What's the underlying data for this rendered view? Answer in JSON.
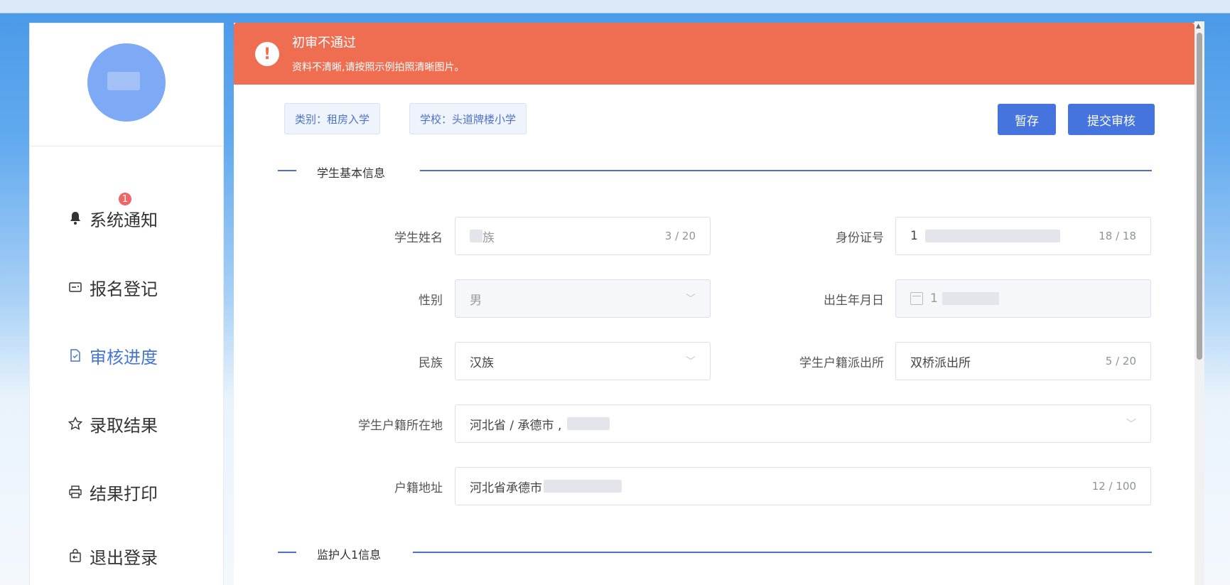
{
  "sidebar": {
    "items": [
      {
        "label": "系统通知",
        "icon": "bell-icon",
        "badge": "1"
      },
      {
        "label": "报名登记",
        "icon": "id-card-icon"
      },
      {
        "label": "审核进度",
        "icon": "document-check-icon",
        "active": true
      },
      {
        "label": "录取结果",
        "icon": "star-icon"
      },
      {
        "label": "结果打印",
        "icon": "printer-icon"
      },
      {
        "label": "退出登录",
        "icon": "logout-icon"
      }
    ]
  },
  "alert": {
    "title": "初审不通过",
    "desc": "资料不清晰,请按照示例拍照清晰图片。"
  },
  "tags": {
    "category": "类别：租房入学",
    "school": "学校：头道牌楼小学"
  },
  "buttons": {
    "save": "暂存",
    "submit": "提交审核"
  },
  "sections": {
    "student": "学生基本信息",
    "guardian": "监护人1信息"
  },
  "form": {
    "name": {
      "label": "学生姓名",
      "value": "族",
      "counter": "3 / 20"
    },
    "id": {
      "label": "身份证号",
      "value": "1",
      "counter": "18 / 18"
    },
    "gender": {
      "label": "性别",
      "value": "男"
    },
    "birth": {
      "label": "出生年月日",
      "value": "1"
    },
    "ethnicity": {
      "label": "民族",
      "value": "汉族"
    },
    "police": {
      "label": "学生户籍派出所",
      "value": "双桥派出所",
      "counter": "5 / 20"
    },
    "household": {
      "label": "学生户籍所在地",
      "value": "河北省 / 承德市 ,"
    },
    "address": {
      "label": "户籍地址",
      "value": "河北省承德市",
      "counter": "12 / 100"
    }
  },
  "colors": {
    "alert": "#ef6e52",
    "accent": "#4674de",
    "active_nav": "#4474d4"
  }
}
